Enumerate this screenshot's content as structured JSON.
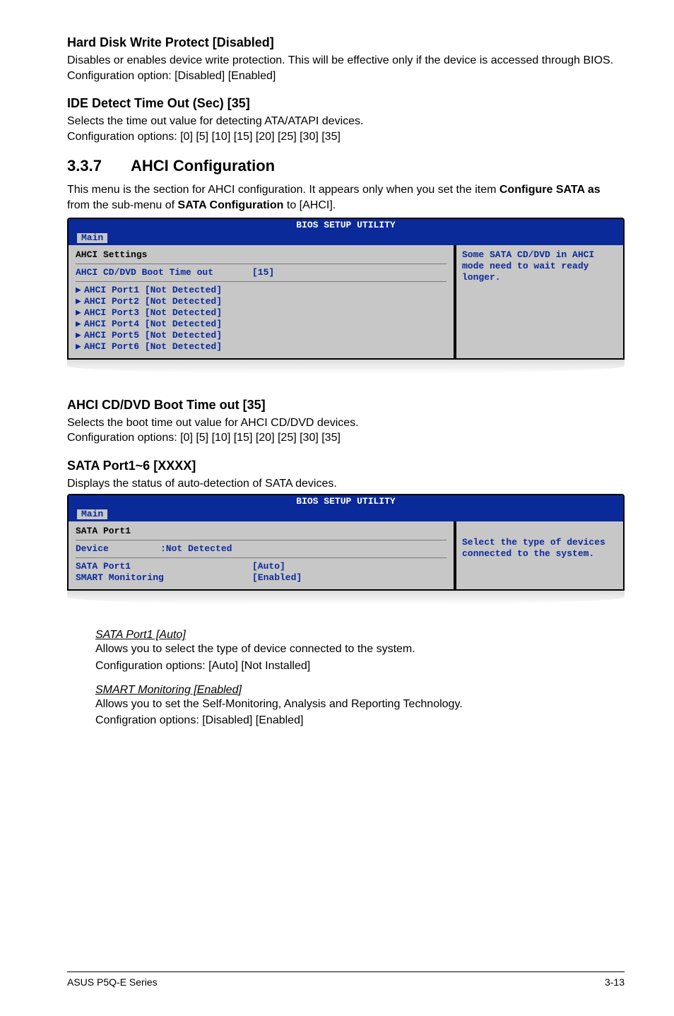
{
  "section1": {
    "heading": "Hard Disk Write Protect [Disabled]",
    "para": "Disables or enables device write protection. This will be effective only if the device is accessed through BIOS.\nConfiguration option: [Disabled] [Enabled]"
  },
  "section2": {
    "heading": "IDE Detect Time Out (Sec) [35]",
    "para": "Selects the time out value for detecting ATA/ATAPI devices.\nConfiguration options: [0] [5] [10] [15] [20] [25] [30] [35]"
  },
  "section3": {
    "number": "3.3.7",
    "title": "AHCI Configuration",
    "intro_pre": "This menu is the section for AHCI configuration. It appears only when you set the item ",
    "intro_bold1": "Configure SATA as",
    "intro_mid": " from the sub-menu of ",
    "intro_bold2": "SATA Configuration",
    "intro_post": " to [AHCI]."
  },
  "bios1": {
    "title": "BIOS SETUP UTILITY",
    "tab": "Main",
    "left_heading": "AHCI Settings",
    "boot_time_label": "AHCI CD/DVD Boot Time out",
    "boot_time_value": "[15]",
    "ports": [
      "AHCI Port1 [Not Detected]",
      "AHCI Port2 [Not Detected]",
      "AHCI Port3 [Not Detected]",
      "AHCI Port4 [Not Detected]",
      "AHCI Port5 [Not Detected]",
      "AHCI Port6 [Not Detected]"
    ],
    "help": "Some SATA CD/DVD in AHCI mode need to wait ready longer."
  },
  "section4": {
    "heading": "AHCI CD/DVD Boot Time out [35]",
    "para": "Selects the boot time out value for AHCI CD/DVD devices.\nConfiguration options: [0] [5] [10] [15] [20] [25] [30] [35]"
  },
  "section5": {
    "heading": "SATA Port1~6 [XXXX]",
    "para": "Displays the status of auto-detection of SATA devices."
  },
  "bios2": {
    "title": "BIOS SETUP UTILITY",
    "tab": "Main",
    "left_heading": "SATA Port1",
    "device_label": "Device",
    "device_value": ":Not Detected",
    "rows": [
      {
        "k": "SATA Port1",
        "v": "[Auto]"
      },
      {
        "k": "SMART Monitoring",
        "v": "[Enabled]"
      }
    ],
    "help": "Select the type of devices connected to the system."
  },
  "sub1": {
    "title": "SATA Port1 [Auto]",
    "l1": "Allows you to select the type of device connected to the system.",
    "l2": "Configuration options: [Auto] [Not Installed]"
  },
  "sub2": {
    "title": "SMART Monitoring [Enabled]",
    "l1": "Allows you to set the Self-Monitoring, Analysis and Reporting Technology.",
    "l2": "Configration options: [Disabled] [Enabled]"
  },
  "footer": {
    "left": "ASUS P5Q-E Series",
    "right": "3-13"
  }
}
